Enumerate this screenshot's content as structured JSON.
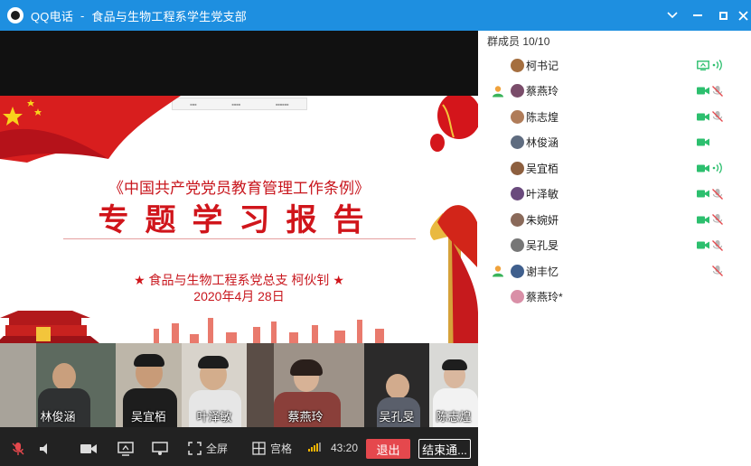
{
  "window": {
    "app_name": "QQ电话",
    "separator": "-",
    "group_name": "食品与生物工程系学生党支部"
  },
  "slide": {
    "title_line1": "《中国共产党党员教育管理工作条例》",
    "title_line2": "专题学习报告",
    "author": "食品与生物工程系党总支  柯伙钊",
    "date": "2020年4月 28日",
    "collapse_label": "收起"
  },
  "thumbnails": [
    {
      "name": "林俊涵"
    },
    {
      "name": "吴宜栢"
    },
    {
      "name": "叶泽敏"
    },
    {
      "name": "蔡燕玲"
    },
    {
      "name": "吴孔旻"
    },
    {
      "name": "陈志煌"
    }
  ],
  "toolbar": {
    "fullscreen_label": "全屏",
    "grid_label": "宫格",
    "timer": "43:20",
    "exit_label": "退出",
    "end_label": "结束通..."
  },
  "members_panel": {
    "header": "群成员 10/10",
    "members": [
      {
        "name": "柯书记",
        "host": false,
        "camera": "share",
        "mic": "on"
      },
      {
        "name": "蔡燕玲",
        "host": true,
        "camera": "on",
        "mic": "muted"
      },
      {
        "name": "陈志煌",
        "host": false,
        "camera": "on",
        "mic": "muted"
      },
      {
        "name": "林俊涵",
        "host": false,
        "camera": "on",
        "mic": "none"
      },
      {
        "name": "吴宜栢",
        "host": false,
        "camera": "on",
        "mic": "on"
      },
      {
        "name": "叶泽敏",
        "host": false,
        "camera": "on",
        "mic": "muted"
      },
      {
        "name": "朱婉妍",
        "host": false,
        "camera": "on",
        "mic": "muted"
      },
      {
        "name": "吴孔旻",
        "host": false,
        "camera": "on",
        "mic": "muted"
      },
      {
        "name": "谢丰忆",
        "host": true,
        "camera": "none",
        "mic": "muted"
      },
      {
        "name": "蔡燕玲*",
        "host": false,
        "camera": "none",
        "mic": "none"
      }
    ]
  },
  "colors": {
    "titlebar": "#1e8fe0",
    "active_green": "#2cbf6e",
    "muted_gray": "#b8b8b8",
    "slide_red": "#c8161d",
    "exit_red": "#e5484d"
  }
}
